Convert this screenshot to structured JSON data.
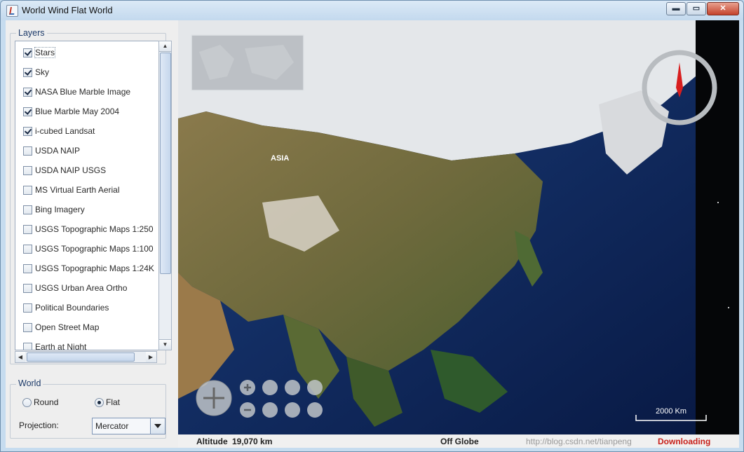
{
  "window": {
    "title": "World Wind Flat World",
    "buttons": {
      "minimize": "▬",
      "maximize": "▭",
      "close": "✕"
    }
  },
  "layers": {
    "legend": "Layers",
    "items": [
      {
        "label": "Stars",
        "checked": true
      },
      {
        "label": "Sky",
        "checked": true
      },
      {
        "label": "NASA Blue Marble Image",
        "checked": true
      },
      {
        "label": "Blue Marble May 2004",
        "checked": true
      },
      {
        "label": "i-cubed Landsat",
        "checked": true
      },
      {
        "label": "USDA NAIP",
        "checked": false
      },
      {
        "label": "USDA NAIP USGS",
        "checked": false
      },
      {
        "label": "MS Virtual Earth Aerial",
        "checked": false
      },
      {
        "label": "Bing Imagery",
        "checked": false
      },
      {
        "label": "USGS Topographic Maps 1:250",
        "checked": false
      },
      {
        "label": "USGS Topographic Maps 1:100",
        "checked": false
      },
      {
        "label": "USGS Topographic Maps 1:24K",
        "checked": false
      },
      {
        "label": "USGS Urban Area Ortho",
        "checked": false
      },
      {
        "label": "Political Boundaries",
        "checked": false
      },
      {
        "label": "Open Street Map",
        "checked": false
      },
      {
        "label": "Earth at Night",
        "checked": false
      }
    ]
  },
  "world": {
    "legend": "World",
    "round_label": "Round",
    "flat_label": "Flat",
    "selected": "Flat",
    "projection_label": "Projection:",
    "projection_value": "Mercator"
  },
  "map": {
    "region_label": "ASIA",
    "scale_label": "2000 Km",
    "colors": {
      "ocean": "#0b1f52",
      "land": "#7d6a3f",
      "ice": "#e9ecef",
      "compass": "#d81e1e"
    }
  },
  "status": {
    "altitude_label": "Altitude",
    "altitude_value": "19,070 km",
    "position": "Off Globe",
    "download": "Downloading",
    "watermark": "http://blog.csdn.net/tianpeng"
  }
}
